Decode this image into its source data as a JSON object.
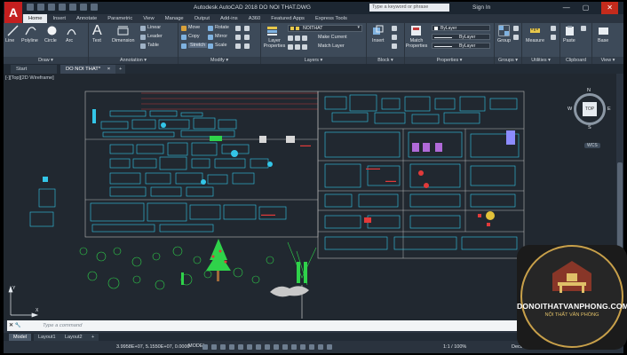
{
  "titlebar": {
    "app_logo": "A",
    "title": "Autodesk AutoCAD 2018    DO NOI THAT.DWG",
    "search_placeholder": "Type a keyword or phrase",
    "signin": "Sign In",
    "minimize": "—",
    "maximize": "▢",
    "close": "✕"
  },
  "ribbon_tabs": [
    "Home",
    "Insert",
    "Annotate",
    "Parametric",
    "View",
    "Manage",
    "Output",
    "Add-ins",
    "A360",
    "Featured Apps",
    "Express Tools"
  ],
  "ribbon": {
    "draw": {
      "label": "Draw ▾",
      "line": "Line",
      "polyline": "Polyline",
      "circle": "Circle",
      "arc": "Arc"
    },
    "modify": {
      "label": "Modify ▾",
      "move": "Move",
      "rotate": "Rotate",
      "copy": "Copy",
      "mirror": "Mirror",
      "stretch": "Stretch",
      "scale": "Scale"
    },
    "annotation": {
      "label": "Annotation ▾",
      "text": "Text",
      "dimension": "Dimension",
      "linear": "Linear",
      "leader": "Leader",
      "table": "Table"
    },
    "layers": {
      "label": "Layers ▾",
      "layer_properties": "Layer Properties",
      "current_layer": "NOITHAT",
      "make_current": "Make Current",
      "match_layer": "Match Layer"
    },
    "block": {
      "label": "Block ▾",
      "insert": "Insert"
    },
    "properties": {
      "label": "Properties ▾",
      "match_properties": "Match Properties",
      "bylayer_1": "ByLayer",
      "bylayer_2": "ByLayer",
      "bylayer_3": "ByLayer"
    },
    "groups": {
      "label": "Groups ▾",
      "group": "Group"
    },
    "utilities": {
      "label": "Utilities ▾",
      "measure": "Measure"
    },
    "clipboard": {
      "label": "Clipboard",
      "paste": "Paste"
    },
    "view": {
      "label": "View ▾",
      "base": "Base"
    }
  },
  "file_tabs": {
    "start": "Start",
    "active": "DO NOI THAT*",
    "close": "×",
    "add": "+"
  },
  "canvas": {
    "view_label": "[-][Top][2D Wireframe]",
    "viewcube_top": "TOP",
    "north": "N",
    "south": "S",
    "east": "E",
    "west": "W",
    "wcs": "WCS"
  },
  "command": {
    "placeholder": "Type a command"
  },
  "layout_tabs": [
    "Model",
    "Layout1",
    "Layout2"
  ],
  "status": {
    "coords": "3.9958E+07, 5.1550E+07, 0.0000",
    "model": "MODEL",
    "scale": "1:1 / 100%",
    "units": "Decimal"
  },
  "watermark": {
    "title": "DONOITHATVANPHONG.COM",
    "subtitle": "NỘI THẤT VĂN PHÒNG"
  },
  "colors": {
    "ribbon": "#3d4a59",
    "canvas": "#212830",
    "accent": "#c41f1f",
    "cad_cyan": "#33c6e8",
    "cad_green": "#2fd24a",
    "cad_red": "#e23a3a"
  }
}
